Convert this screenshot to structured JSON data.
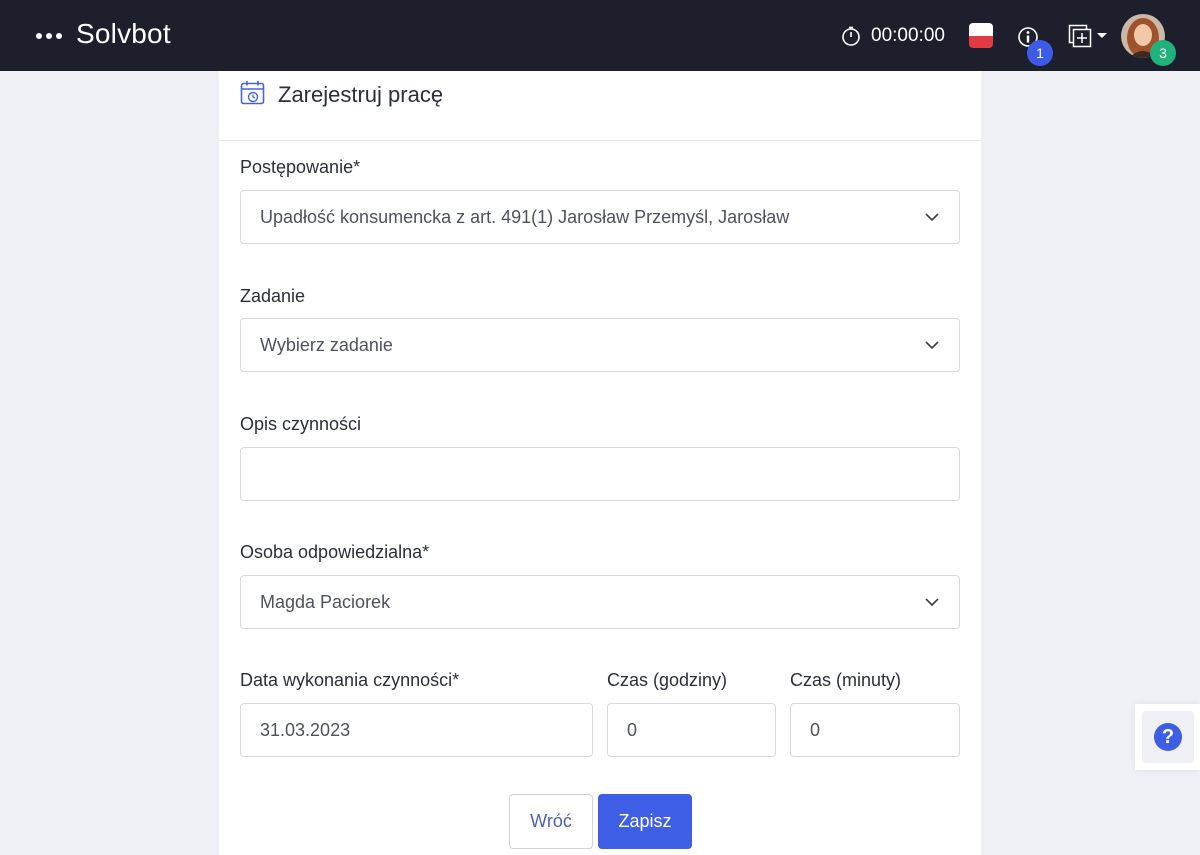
{
  "topbar": {
    "brand": "Solvbot",
    "timer": "00:00:00",
    "info_badge": "1",
    "avatar_badge": "3",
    "icons": [
      "menu-dots-icon",
      "stopwatch-icon",
      "flag-icon",
      "info-icon",
      "add-window-icon",
      "caret-down-icon"
    ]
  },
  "card": {
    "title": "Zarejestruj pracę",
    "title_icon": "calendar-clock-icon"
  },
  "form": {
    "proceeding": {
      "label": "Postępowanie*",
      "value": "Upadłość konsumencka z art. 491(1) Jarosław Przemyśl, Jarosław"
    },
    "task": {
      "label": "Zadanie",
      "placeholder": "Wybierz zadanie"
    },
    "description": {
      "label": "Opis czynności",
      "value": ""
    },
    "responsible": {
      "label": "Osoba odpowiedzialna*",
      "value": "Magda Paciorek"
    },
    "date": {
      "label": "Data wykonania czynności*",
      "value": "31.03.2023"
    },
    "hours": {
      "label": "Czas (godziny)",
      "value": "0"
    },
    "minutes": {
      "label": "Czas (minuty)",
      "value": "0"
    }
  },
  "actions": {
    "back_label": "Wróć",
    "save_label": "Zapisz"
  },
  "help": {
    "icon_text": "?"
  },
  "colors": {
    "topbar": "#1e1f2c",
    "accent": "#3f5ee6",
    "info_badge": "#3e5be8",
    "avatar_badge": "#20b27a",
    "background": "#eef0f5"
  }
}
